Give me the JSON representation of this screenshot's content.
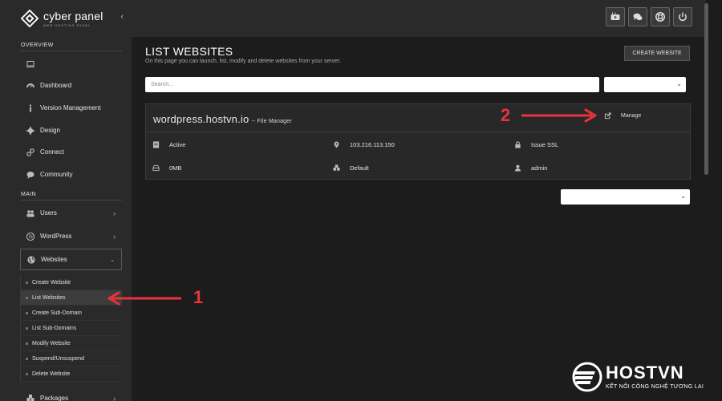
{
  "brand": {
    "name": "cyber panel",
    "tagline": "WEB HOSTING PANEL"
  },
  "sidebar": {
    "overview_label": "OVERVIEW",
    "main_label": "MAIN",
    "overview_items": [
      {
        "label": "",
        "icon": "monitor-icon"
      },
      {
        "label": "Dashboard",
        "icon": "dashboard-icon"
      },
      {
        "label": "Version Management",
        "icon": "info-icon"
      },
      {
        "label": "Design",
        "icon": "gear-icon"
      },
      {
        "label": "Connect",
        "icon": "link-icon"
      },
      {
        "label": "Community",
        "icon": "chat-icon"
      }
    ],
    "main_items": [
      {
        "label": "Users",
        "icon": "users-icon"
      },
      {
        "label": "WordPress",
        "icon": "wordpress-icon"
      },
      {
        "label": "Websites",
        "icon": "globe-icon"
      },
      {
        "label": "Packages",
        "icon": "packages-icon"
      }
    ],
    "website_sub_items": [
      "Create Website",
      "List Websites",
      "Create Sub-Domain",
      "List Sub-Domains",
      "Modify Website",
      "Suspend/Unsuspend",
      "Delete Website"
    ]
  },
  "topbar": {
    "buttons": [
      "youtube-icon",
      "chat-bubbles-icon",
      "lifebuoy-icon",
      "power-icon"
    ]
  },
  "main": {
    "title": "LIST WEBSITES",
    "description": "On this page you can launch, list, modify and delete websites from your server.",
    "create_button": "CREATE WEBSITE",
    "search_placeholder": "Search...",
    "website": {
      "domain": "wordpress.hostvn.io",
      "file_manager": "-- File Manager",
      "manage": "Manage",
      "state": "Active",
      "ip": "103.216.113.150",
      "ssl": "Issue SSL",
      "disk": "0MB",
      "package": "Default",
      "owner": "admin"
    }
  },
  "annotations": {
    "step1": "1",
    "step2": "2",
    "color": "#e8333a"
  },
  "watermark": {
    "name": "HOSTVN",
    "tagline": "KẾT NỐI CÔNG NGHỆ TƯƠNG LAI"
  }
}
